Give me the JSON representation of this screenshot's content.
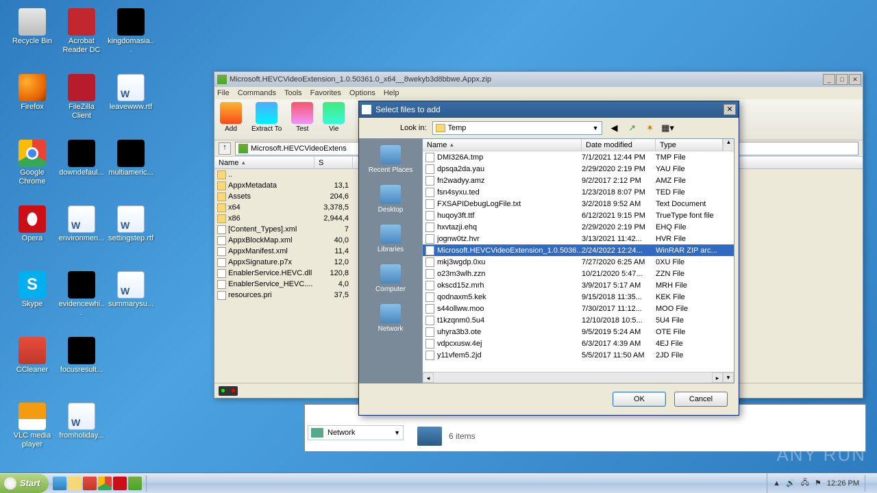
{
  "desktop_icons": [
    {
      "label": "Recycle Bin",
      "cls": "ic-trash"
    },
    {
      "label": "Acrobat Reader DC",
      "cls": "ic-adobe"
    },
    {
      "label": "kingdomasia...",
      "cls": "ic-black"
    },
    {
      "label": "Firefox",
      "cls": "ic-firefox"
    },
    {
      "label": "FileZilla Client",
      "cls": "ic-fz"
    },
    {
      "label": "leavewww.rtf",
      "cls": "ic-doc"
    },
    {
      "label": "Google Chrome",
      "cls": "ic-chrome"
    },
    {
      "label": "downdefaul...",
      "cls": "ic-black"
    },
    {
      "label": "multiameric...",
      "cls": "ic-black"
    },
    {
      "label": "Opera",
      "cls": "ic-opera"
    },
    {
      "label": "environmen...",
      "cls": "ic-doc"
    },
    {
      "label": "settingstep.rtf",
      "cls": "ic-doc"
    },
    {
      "label": "Skype",
      "cls": "ic-skype"
    },
    {
      "label": "evidencewhi...",
      "cls": "ic-black"
    },
    {
      "label": "summarysu...",
      "cls": "ic-doc"
    },
    {
      "label": "CCleaner",
      "cls": "ic-ccleaner"
    },
    {
      "label": "focusresult...",
      "cls": "ic-black"
    },
    {
      "label": "",
      "cls": ""
    },
    {
      "label": "VLC media player",
      "cls": "ic-vlc"
    },
    {
      "label": "fromholiday...",
      "cls": "ic-doc"
    }
  ],
  "winrar": {
    "title": "Microsoft.HEVCVideoExtension_1.0.50361.0_x64__8wekyb3d8bbwe.Appx.zip",
    "menu": [
      "File",
      "Commands",
      "Tools",
      "Favorites",
      "Options",
      "Help"
    ],
    "toolbar": [
      {
        "label": "Add",
        "cls": "tic-add"
      },
      {
        "label": "Extract To",
        "cls": "tic-ext"
      },
      {
        "label": "Test",
        "cls": "tic-test"
      },
      {
        "label": "Vie",
        "cls": "tic-vie"
      }
    ],
    "path": "Microsoft.HEVCVideoExtens",
    "columns": {
      "name": "Name",
      "size": "S"
    },
    "files": [
      {
        "n": "..",
        "s": "",
        "folder": true
      },
      {
        "n": "AppxMetadata",
        "s": "13,1",
        "folder": true
      },
      {
        "n": "Assets",
        "s": "204,6",
        "folder": true
      },
      {
        "n": "x64",
        "s": "3,378,5",
        "folder": true
      },
      {
        "n": "x86",
        "s": "2,944,4",
        "folder": true
      },
      {
        "n": "[Content_Types].xml",
        "s": "7",
        "folder": false
      },
      {
        "n": "AppxBlockMap.xml",
        "s": "40,0",
        "folder": false
      },
      {
        "n": "AppxManifest.xml",
        "s": "11,4",
        "folder": false
      },
      {
        "n": "AppxSignature.p7x",
        "s": "12,0",
        "folder": false
      },
      {
        "n": "EnablerService.HEVC.dll",
        "s": "120,8",
        "folder": false
      },
      {
        "n": "EnablerService_HEVC....",
        "s": "4,0",
        "folder": false
      },
      {
        "n": "resources.pri",
        "s": "37,5",
        "folder": false
      }
    ]
  },
  "dialog": {
    "title": "Select files to add",
    "lookin_label": "Look in:",
    "lookin_value": "Temp",
    "places": [
      "Recent Places",
      "Desktop",
      "Libraries",
      "Computer",
      "Network"
    ],
    "columns": {
      "name": "Name",
      "date": "Date modified",
      "type": "Type"
    },
    "rows": [
      {
        "n": "DMI326A.tmp",
        "d": "7/1/2021 12:44 PM",
        "t": "TMP File"
      },
      {
        "n": "dpsqa2da.yau",
        "d": "2/29/2020 2:19 PM",
        "t": "YAU File"
      },
      {
        "n": "fn2wadyy.amz",
        "d": "9/2/2017 2:12 PM",
        "t": "AMZ File"
      },
      {
        "n": "fsn4syxu.ted",
        "d": "1/23/2018 8:07 PM",
        "t": "TED File"
      },
      {
        "n": "FXSAPIDebugLogFile.txt",
        "d": "3/2/2018 9:52 AM",
        "t": "Text Document"
      },
      {
        "n": "huqoy3ft.ttf",
        "d": "6/12/2021 9:15 PM",
        "t": "TrueType font file"
      },
      {
        "n": "hxvtazji.ehq",
        "d": "2/29/2020 2:19 PM",
        "t": "EHQ File"
      },
      {
        "n": "jognw0tz.hvr",
        "d": "3/13/2021 11:42...",
        "t": "HVR File"
      },
      {
        "n": "Microsoft.HEVCVideoExtension_1.0.5036...",
        "d": "2/24/2022 12:24...",
        "t": "WinRAR ZIP arc...",
        "sel": true
      },
      {
        "n": "mkj3wgdp.0xu",
        "d": "7/27/2020 6:25 AM",
        "t": "0XU File"
      },
      {
        "n": "o23m3wlh.zzn",
        "d": "10/21/2020 5:47...",
        "t": "ZZN File"
      },
      {
        "n": "okscd15z.mrh",
        "d": "3/9/2017 5:17 AM",
        "t": "MRH File"
      },
      {
        "n": "qodnaxm5.kek",
        "d": "9/15/2018 11:35...",
        "t": "KEK File"
      },
      {
        "n": "s44ollww.moo",
        "d": "7/30/2017 11:12...",
        "t": "MOO File"
      },
      {
        "n": "t1kzqnm0.5u4",
        "d": "12/10/2018 10:5...",
        "t": "5U4 File"
      },
      {
        "n": "uhyra3b3.ote",
        "d": "9/5/2019 5:24 AM",
        "t": "OTE File"
      },
      {
        "n": "vdpcxusw.4ej",
        "d": "6/3/2017 4:39 AM",
        "t": "4EJ File"
      },
      {
        "n": "y11vfem5.2jd",
        "d": "5/5/2017 11:50 AM",
        "t": "2JD File"
      }
    ],
    "ok": "OK",
    "cancel": "Cancel"
  },
  "explorer": {
    "network": "Network",
    "items": "6 items"
  },
  "taskbar": {
    "start": "Start",
    "time": "12:26 PM"
  },
  "watermark": "ANY    RUN"
}
